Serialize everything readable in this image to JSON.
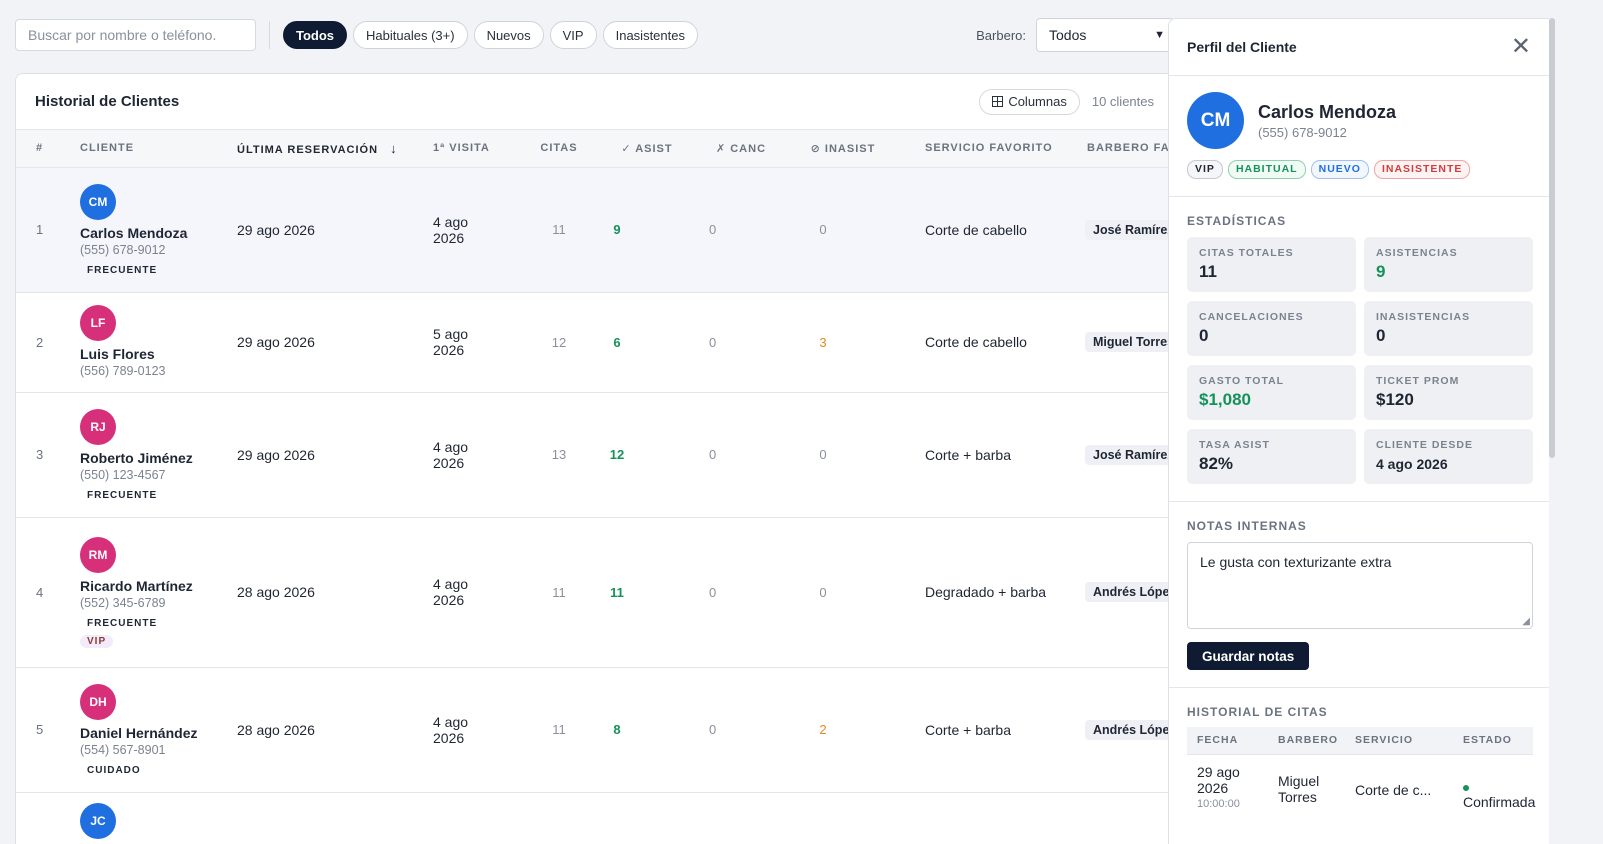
{
  "toolbar": {
    "search_placeholder": "Buscar por nombre o teléfono.",
    "filters": [
      "Todos",
      "Habituales (3+)",
      "Nuevos",
      "VIP",
      "Inasistentes"
    ],
    "barbero_label": "Barbero:",
    "barbero_value": "Todos"
  },
  "table": {
    "title": "Historial de Clientes",
    "columns_button": "Columnas",
    "count_label": "10 clientes",
    "headers": [
      "#",
      "Cliente",
      "Última reservación",
      "1ª visita",
      "Citas",
      "✓ Asist",
      "✗ Canc",
      "⊘ Inasist",
      "Servicio favorito",
      "Barbero fav"
    ],
    "sort_indicator": "↓",
    "rows": [
      {
        "idx": "1",
        "initials": "CM",
        "avatar_color": "#1f6fe0",
        "name": "Carlos Mendoza",
        "phone": "(555) 678-9012",
        "tag": "FRECUENTE",
        "vip": "",
        "last": "29 ago 2026",
        "first": "4 ago 2026",
        "citas": "11",
        "asist": "9",
        "canc": "0",
        "inasist": "0",
        "servicio": "Corte de cabello",
        "barbero": "José Ramírez"
      },
      {
        "idx": "2",
        "initials": "LF",
        "avatar_color": "#d6307a",
        "name": "Luis Flores",
        "phone": "(556) 789-0123",
        "tag": "",
        "vip": "",
        "last": "29 ago 2026",
        "first": "5 ago 2026",
        "citas": "12",
        "asist": "6",
        "canc": "0",
        "inasist": "3",
        "servicio": "Corte de cabello",
        "barbero": "Miguel Torres"
      },
      {
        "idx": "3",
        "initials": "RJ",
        "avatar_color": "#d6307a",
        "name": "Roberto Jiménez",
        "phone": "(550) 123-4567",
        "tag": "FRECUENTE",
        "vip": "",
        "last": "29 ago 2026",
        "first": "4 ago 2026",
        "citas": "13",
        "asist": "12",
        "canc": "0",
        "inasist": "0",
        "servicio": "Corte + barba",
        "barbero": "José Ramírez"
      },
      {
        "idx": "4",
        "initials": "RM",
        "avatar_color": "#d6307a",
        "name": "Ricardo Martínez",
        "phone": "(552) 345-6789",
        "tag": "FRECUENTE",
        "vip": "VIP",
        "last": "28 ago 2026",
        "first": "4 ago 2026",
        "citas": "11",
        "asist": "11",
        "canc": "0",
        "inasist": "0",
        "servicio": "Degradado + barba",
        "barbero": "Andrés López"
      },
      {
        "idx": "5",
        "initials": "DH",
        "avatar_color": "#d6307a",
        "name": "Daniel Hernández",
        "phone": "(554) 567-8901",
        "tag": "CUIDADO",
        "vip": "",
        "last": "28 ago 2026",
        "first": "4 ago 2026",
        "citas": "11",
        "asist": "8",
        "canc": "0",
        "inasist": "2",
        "servicio": "Corte + barba",
        "barbero": "Andrés López"
      },
      {
        "idx": "",
        "initials": "JC",
        "avatar_color": "#1f6fe0",
        "name": "",
        "phone": "",
        "tag": "",
        "vip": "",
        "last": "",
        "first": "",
        "citas": "",
        "asist": "",
        "canc": "",
        "inasist": "",
        "servicio": "",
        "barbero": ""
      }
    ]
  },
  "panel": {
    "title": "Perfil del Cliente",
    "initials": "CM",
    "name": "Carlos Mendoza",
    "phone": "(555) 678-9012",
    "badges": [
      "VIP",
      "HABITUAL",
      "NUEVO",
      "INASISTENTE"
    ],
    "stats_title": "Estadísticas",
    "stats": [
      {
        "label": "Citas totales",
        "value": "11"
      },
      {
        "label": "Asistencias",
        "value": "9"
      },
      {
        "label": "Cancelaciones",
        "value": "0"
      },
      {
        "label": "Inasistencias",
        "value": "0"
      },
      {
        "label": "Gasto total",
        "value": "$1,080"
      },
      {
        "label": "Ticket prom",
        "value": "$120"
      },
      {
        "label": "Tasa asist",
        "value": "82%"
      },
      {
        "label": "Cliente desde",
        "value": "4 ago 2026"
      }
    ],
    "notes_title": "Notas internas",
    "notes_text": "Le gusta con texturizante extra",
    "save_button": "Guardar notas",
    "history_title": "Historial de citas",
    "history_headers": [
      "Fecha",
      "Barbero",
      "Servicio",
      "Estado"
    ],
    "history_rows": [
      {
        "date": "29 ago 2026",
        "time": "10:00:00",
        "barber": "Miguel Torres",
        "service": "Corte de c...",
        "status": "Confirmada"
      }
    ]
  }
}
